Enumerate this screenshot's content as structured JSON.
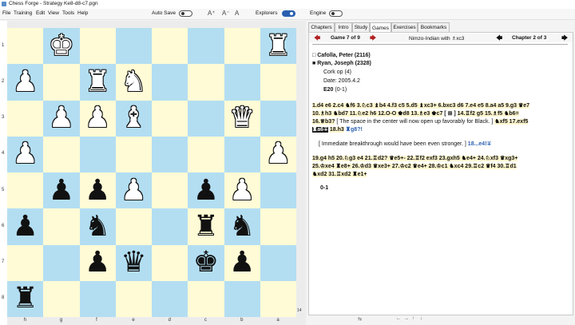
{
  "window": {
    "title": "Chess Forge - Strategy Ke8-d8-c7.pgn"
  },
  "menu": {
    "items": [
      "File",
      "Training",
      "Edit",
      "View",
      "Tools",
      "Help"
    ]
  },
  "toolbar": {
    "autosave_label": "Auto Save",
    "explorers_label": "Explorers",
    "engine_label": "Engine"
  },
  "tabs": [
    "Chapters",
    "Intro",
    "Study",
    "Games",
    "Exercises",
    "Bookmarks"
  ],
  "active_tab": "Games",
  "nav": {
    "game_label": "Game 7 of 9",
    "opening": "Nimzo-Indian with ♗xc3",
    "chapter_label": "Chapter 2 of 3"
  },
  "game": {
    "white": "Cafolla, Peter (2116)",
    "black": "Ryan, Joseph (2328)",
    "event": "Cork op (4)",
    "date": "Date: 2005.4.2",
    "eco": "E20",
    "eco_result": "(0-1)",
    "moves_1": "1.d4 e6 2.c4 ♞f6 3.♘c3 ♝b4 4.f3 c5 5.d5 ♝xc3+ 6.bxc3 d6 7.e4 e5 8.a4 a5 9.g3 ♛e7",
    "moves_2": "10.♗h3 ♞bd7 11.♘e2 h6 12.O-O ♚d8 13.♗e3 ♚c7",
    "moves_2_tail": "14.♖f2 g5 15.♗f5 ♞b6=",
    "moves_3_head": "16.♕b3?",
    "moves_3_note": "[ The space in the center will now open up favorably for Black. ]",
    "moves_3_tail": "♞xf5 17.exf5",
    "moves_4_cur": "♜a6∓",
    "moves_4": "18.h3",
    "moves_4_blue": "♜g8?!",
    "note_2": "[ Immediate breakthrough would have been even stronger. ]",
    "note_2_blue": "18...e4!∓",
    "moves_5": "19.g4 h5 20.♘g3 e4 21.♖d2? ♛e5+- 22.♖f2 exf3 23.gxh5 ♞e4+ 24.♘xf3 ♛xg3+",
    "moves_6": "25.♔xe4 ♜e8+ 26.♔d3 ♛xe3+ 27.♔c2 ♛e4+ 28.♔c1 ♞xc4 29.♖c2 ♛f4 30.♖d1",
    "moves_7": "♞xd2 31.♖xd2 ♜e1+",
    "result": "0-1"
  },
  "board": {
    "files": [
      "h",
      "g",
      "f",
      "e",
      "d",
      "c",
      "b",
      "a"
    ],
    "ranks": [
      "1",
      "2",
      "3",
      "4",
      "5",
      "6",
      "7",
      "8"
    ],
    "pieces": [
      {
        "sq": "g1",
        "glyph": "♚",
        "color": "w"
      },
      {
        "sq": "a1",
        "glyph": "♜",
        "color": "w"
      },
      {
        "sq": "f2",
        "glyph": "♜",
        "color": "w"
      },
      {
        "sq": "e2",
        "glyph": "♞",
        "color": "w"
      },
      {
        "sq": "h2",
        "glyph": "♟",
        "color": "w"
      },
      {
        "sq": "g3",
        "glyph": "♟",
        "color": "w"
      },
      {
        "sq": "f3",
        "glyph": "♟",
        "color": "w"
      },
      {
        "sq": "e3",
        "glyph": "♝",
        "color": "w"
      },
      {
        "sq": "b3",
        "glyph": "♛",
        "color": "w"
      },
      {
        "sq": "h4",
        "glyph": "♟",
        "color": "w"
      },
      {
        "sq": "a4",
        "glyph": "♟",
        "color": "w"
      },
      {
        "sq": "e5",
        "glyph": "♟",
        "color": "w"
      },
      {
        "sq": "g5",
        "glyph": "♟",
        "color": "b"
      },
      {
        "sq": "f5",
        "glyph": "♟",
        "color": "b"
      },
      {
        "sq": "c5",
        "glyph": "♟",
        "color": "b"
      },
      {
        "sq": "b5",
        "glyph": "♟",
        "color": "w"
      },
      {
        "sq": "h6",
        "glyph": "♟",
        "color": "b"
      },
      {
        "sq": "f6",
        "glyph": "♞",
        "color": "b"
      },
      {
        "sq": "c6",
        "glyph": "♜",
        "color": "b"
      },
      {
        "sq": "b6",
        "glyph": "♞",
        "color": "b"
      },
      {
        "sq": "f7",
        "glyph": "♟",
        "color": "b"
      },
      {
        "sq": "e7",
        "glyph": "♛",
        "color": "b"
      },
      {
        "sq": "c7",
        "glyph": "♚",
        "color": "b"
      },
      {
        "sq": "b7",
        "glyph": "♟",
        "color": "b"
      },
      {
        "sq": "h8",
        "glyph": "♜",
        "color": "b"
      }
    ],
    "move_counter": "14"
  },
  "status_icons": [
    "⇆",
    "←",
    "→",
    "↑",
    "↓"
  ],
  "colors": {
    "light_square": "#fffbd6",
    "dark_square": "#b3def2",
    "accent": "#2a5fb0",
    "nav_arrow": "#b22222"
  }
}
